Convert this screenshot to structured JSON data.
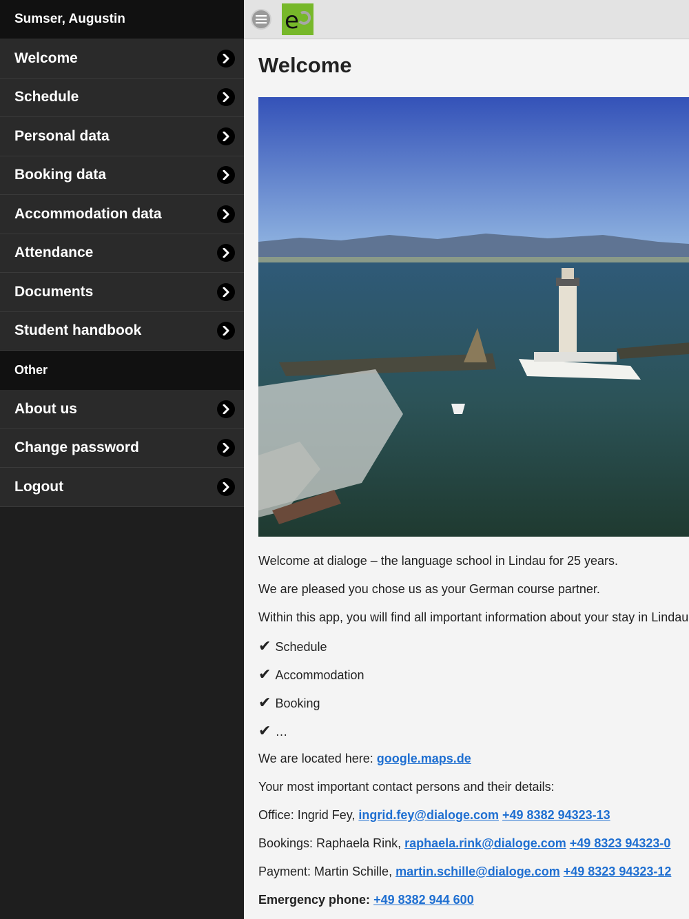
{
  "sidebar": {
    "user_name": "Sumser, Augustin",
    "items": [
      {
        "label": "Welcome"
      },
      {
        "label": "Schedule"
      },
      {
        "label": "Personal data"
      },
      {
        "label": "Booking data"
      },
      {
        "label": "Accommodation data"
      },
      {
        "label": "Attendance"
      },
      {
        "label": "Documents"
      },
      {
        "label": "Student handbook"
      }
    ],
    "section_other": "Other",
    "other_items": [
      {
        "label": "About us"
      },
      {
        "label": "Change password"
      },
      {
        "label": "Logout"
      }
    ]
  },
  "topbar": {
    "menu_icon": "hamburger-icon",
    "logo_text": "e"
  },
  "main": {
    "title": "Welcome",
    "paragraphs": {
      "p1": "Welcome at dialoge – the language school in Lindau for 25 years.",
      "p2": "We are pleased you chose us as your German course partner.",
      "p3": "Within this app, you will find all important information about your stay in Lindau"
    },
    "checklist": [
      "Schedule",
      "Accommodation",
      "Booking",
      "…"
    ],
    "location_label": "We are located here:",
    "location_link": "google.maps.de",
    "contacts_intro": "Your most important contact persons and their details:",
    "contacts": [
      {
        "role": "Office: Ingrid Fey,",
        "email": "ingrid.fey@dialoge.com",
        "phone": "+49 8382 94323-13"
      },
      {
        "role": "Bookings: Raphaela Rink,",
        "email": "raphaela.rink@dialoge.com",
        "phone": "+49 8323 94323-0"
      },
      {
        "role": "Payment: Martin Schille,",
        "email": "martin.schille@dialoge.com",
        "phone": "+49 8323 94323-12"
      }
    ],
    "emergency_label": "Emergency phone:",
    "emergency_phone": "+49 8382 944 600"
  },
  "colors": {
    "sidebar_bg": "#1e1e1e",
    "link": "#1f6fd1",
    "logo_bg": "#77b82a"
  }
}
